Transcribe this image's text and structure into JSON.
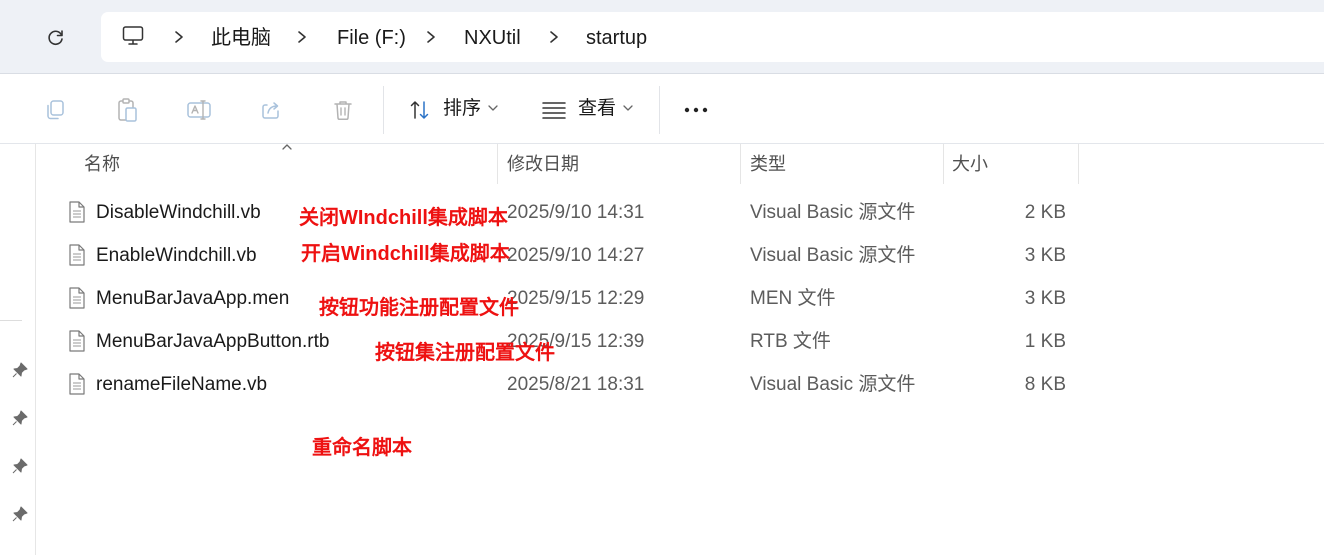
{
  "address_bar": {
    "computer_icon": "computer-icon",
    "breadcrumb": [
      "此电脑",
      "File (F:)",
      "NXUtil",
      "startup"
    ]
  },
  "toolbar": {
    "actions": [
      "copy-icon",
      "paste-icon",
      "rename-icon",
      "share-icon",
      "delete-icon"
    ],
    "sort_label": "排序",
    "view_label": "查看",
    "more_label": "···"
  },
  "columns": {
    "name": "名称",
    "date": "修改日期",
    "type": "类型",
    "size": "大小"
  },
  "files": [
    {
      "name": "DisableWindchill.vb",
      "date": "2025/9/10 14:31",
      "type": "Visual Basic 源文件",
      "size": "2 KB"
    },
    {
      "name": "EnableWindchill.vb",
      "date": "2025/9/10 14:27",
      "type": "Visual Basic 源文件",
      "size": "3 KB"
    },
    {
      "name": "MenuBarJavaApp.men",
      "date": "2025/9/15 12:29",
      "type": "MEN 文件",
      "size": "3 KB"
    },
    {
      "name": "MenuBarJavaAppButton.rtb",
      "date": "2025/9/15 12:39",
      "type": "RTB 文件",
      "size": "1 KB"
    },
    {
      "name": "renameFileName.vb",
      "date": "2025/8/21 18:31",
      "type": "Visual Basic 源文件",
      "size": "8 KB"
    }
  ],
  "annotations": [
    "关闭WIndchill集成脚本",
    "开启Windchill集成脚本",
    "按钮功能注册配置文件",
    "按钮集注册配置文件",
    "重命名脚本"
  ],
  "colors": {
    "annotation": "#ee1111",
    "topbar_bg": "#eef1f6"
  }
}
